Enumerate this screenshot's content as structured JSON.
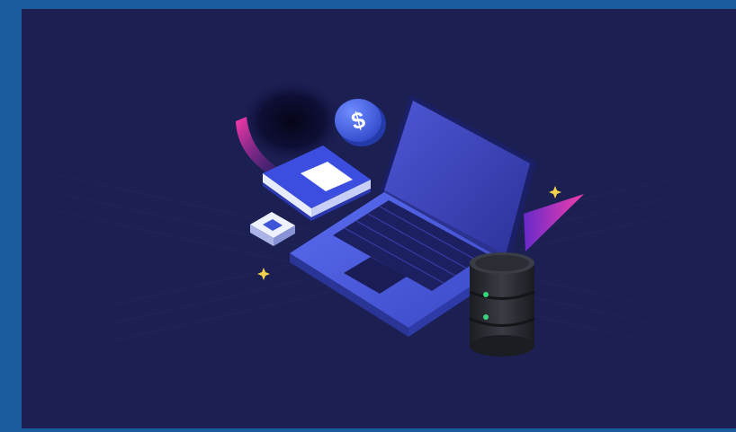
{
  "illustration": {
    "coin_symbol": "$",
    "colors": {
      "frame": "#1a5d9e",
      "background": "#1b1f52",
      "laptop_body": "#4a5ee0",
      "laptop_screen": "#3a44b8",
      "keyboard": "#1d2060",
      "accent_pink": "#e0359a",
      "coin": "#3d63e6",
      "database": "#2a2c33",
      "status_led": "#39d37a"
    },
    "icons": [
      "laptop-icon",
      "book-icon",
      "coin-dollar-icon",
      "chip-icon",
      "database-icon",
      "sparkle-icon"
    ]
  }
}
